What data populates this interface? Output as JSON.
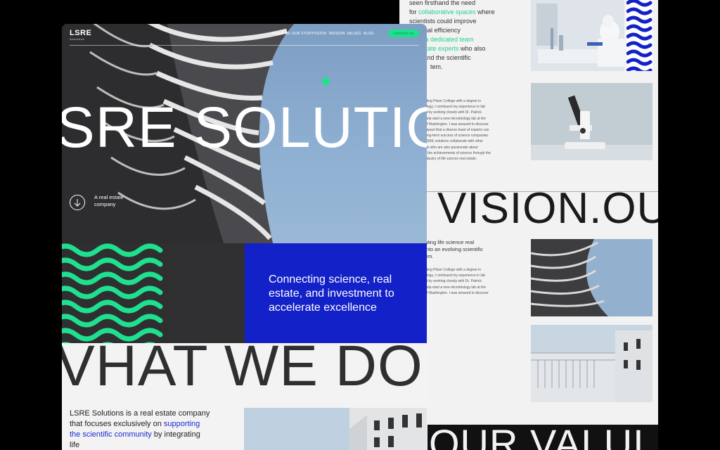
{
  "back": {
    "intro_lines": [
      "seen firsthand the need",
      "for ",
      "collaborative spaces",
      " where",
      "scientists could improve",
      "ional efficiency",
      "ing ",
      "a dedicated team",
      "estate experts",
      " who also",
      "tand the scientific",
      "tem."
    ],
    "bio1_lines": [
      "ating Pitzer College with a degree in",
      "ology, I continued my experience in lab",
      "nt by working closely with Dr. Patrick",
      "help-start a new microbiology lab at the",
      "of Washington. I was amazed to discover",
      "impact that a diverse team of experts can",
      "long-term success of science companies.",
      "LSRE solutions collaborate with other",
      "als who are also passionate about",
      "g the achievements of science through the",
      "ndustry of life science real estate."
    ],
    "vision_title": "VISION.OU",
    "vision_sub_lines": [
      "ating life science real",
      "into an evolving scientific",
      "em."
    ],
    "bio2_lines": [
      "ating Pitzer College with a degree in",
      "ology, I continued my experience in lab",
      "nt by working closely with Dr. Patrick",
      "help-start a new microbiology lab at the",
      "of Washington. I was amazed to discover"
    ],
    "values_title": "OUR VALUI"
  },
  "front": {
    "logo": "LSRE",
    "logo_sub": "Solutions",
    "nav": [
      "ABOUT US",
      "OUR STORY",
      "VISION",
      "MISSION",
      "VALUES",
      "BLOG"
    ],
    "nav_button": "CONTACT US",
    "hero_title": "SRE SOLUTIO",
    "tagline": "A real estate company",
    "blue_text": "Connecting science, real estate, and investment to accelerate excellence",
    "section_title": "VHAT WE DO",
    "desc_parts": [
      "LSRE Solutions is a real estate company that focuses exclusively on ",
      "supporting the scientific community",
      " by integrating life"
    ]
  },
  "colors": {
    "accent_green": "#1fe08f",
    "accent_blue": "#1321c9",
    "dark": "#2f2f31"
  }
}
